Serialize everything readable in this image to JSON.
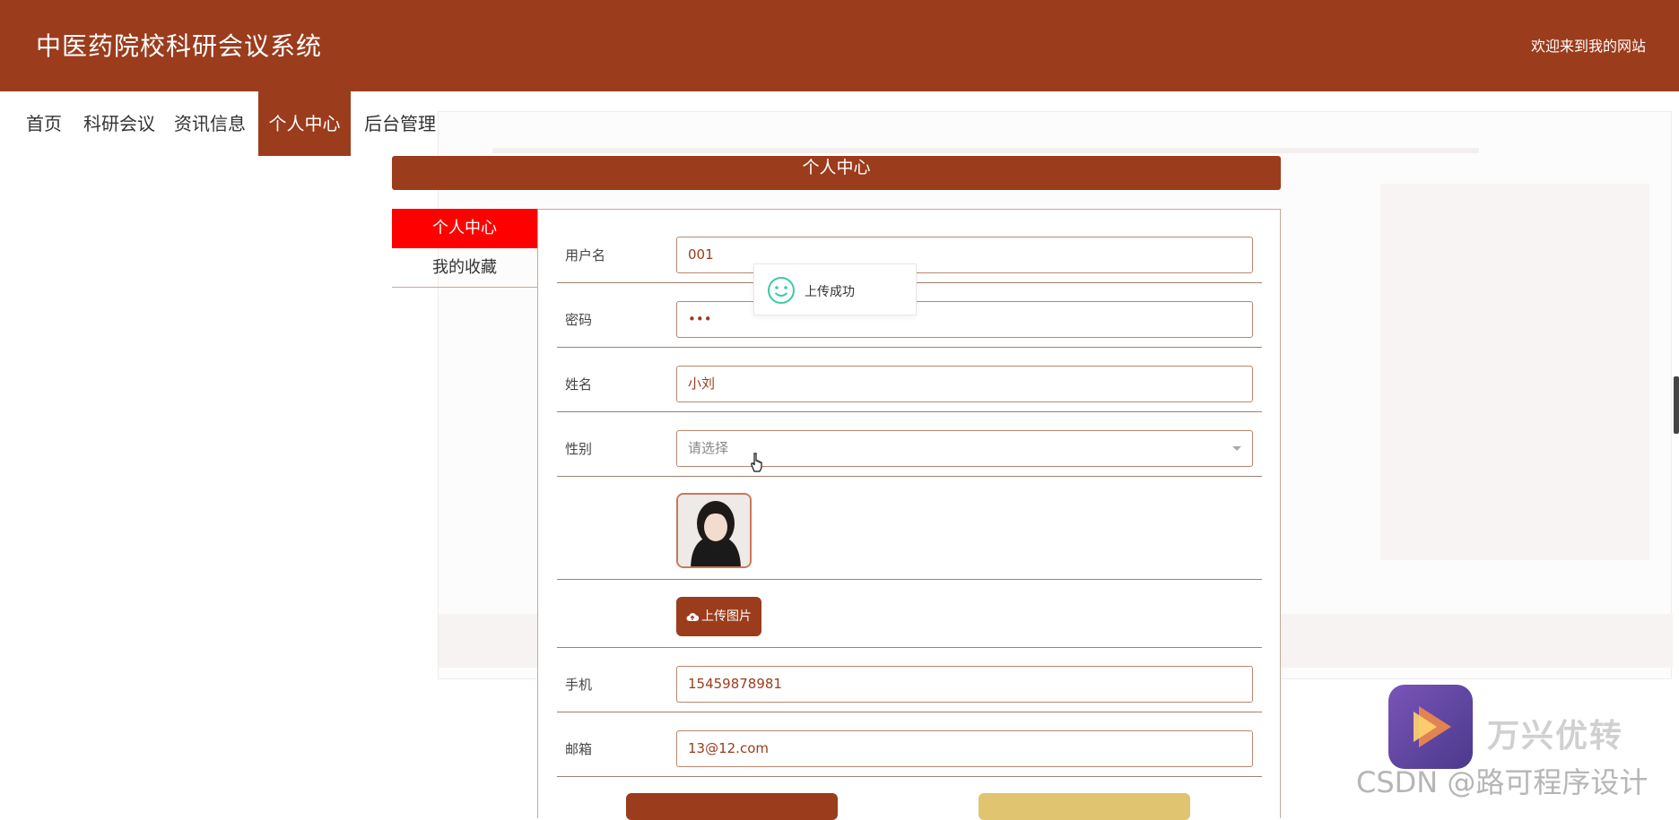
{
  "header": {
    "site_title": "中医药院校科研会议系统",
    "welcome": "欢迎来到我的网站"
  },
  "nav": {
    "items": [
      {
        "label": "首页"
      },
      {
        "label": "科研会议"
      },
      {
        "label": "资讯信息"
      },
      {
        "label": "个人中心",
        "active": true
      },
      {
        "label": "后台管理"
      }
    ]
  },
  "page_title": "个人中心",
  "side_menu": {
    "items": [
      {
        "label": "个人中心",
        "active": true
      },
      {
        "label": "我的收藏"
      }
    ]
  },
  "form": {
    "username_label": "用户名",
    "username_value": "001",
    "password_label": "密码",
    "password_value": "•••",
    "name_label": "姓名",
    "name_value": "小刘",
    "gender_label": "性别",
    "gender_placeholder": "请选择",
    "upload_label": "上传图片",
    "phone_label": "手机",
    "phone_value": "15459878981",
    "email_label": "邮箱",
    "email_value": "13@12.com"
  },
  "toast": {
    "message": "上传成功"
  },
  "watermark": {
    "app_name": "万兴优转",
    "csdn": "CSDN @路可程序设计"
  },
  "colors": {
    "brand": "#9b3c1d",
    "active_side": "#ff0000",
    "toast_icon": "#3cc9a8"
  }
}
